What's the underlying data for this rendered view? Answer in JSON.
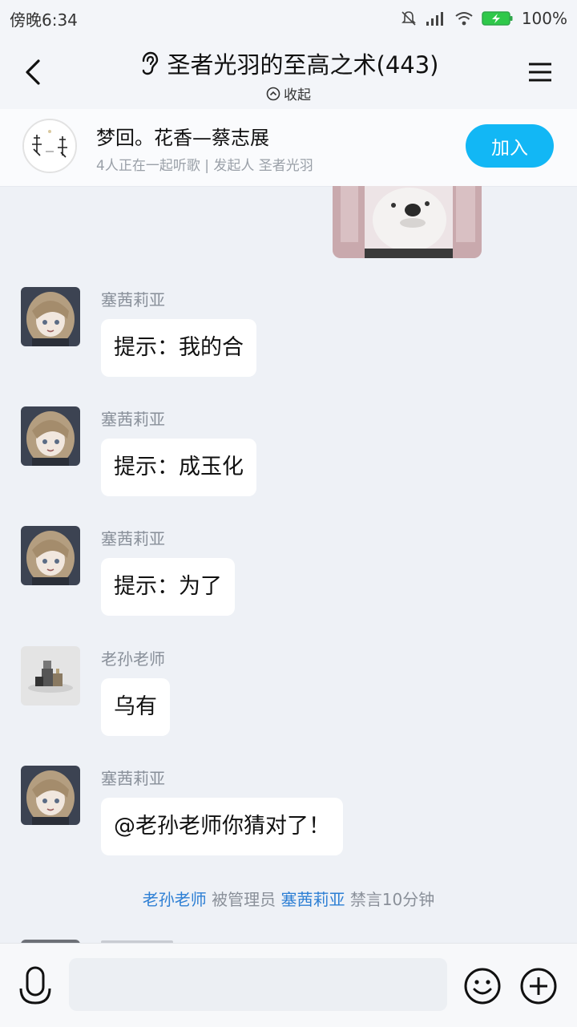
{
  "status_bar": {
    "time": "傍晚6:34",
    "battery": "100%",
    "icons": [
      "mute-bell-icon",
      "signal-icon",
      "wifi-icon",
      "battery-charging-icon"
    ]
  },
  "header": {
    "title": "圣者光羽的至高之术(443)",
    "collapse_label": "收起",
    "icons": [
      "back-arrow-icon",
      "ear-icon",
      "collapse-circle-icon",
      "menu-icon"
    ]
  },
  "music_bar": {
    "song": "梦回。花香—蔡志展",
    "subtitle": "4人正在一起听歌 | 发起人 圣者光羽",
    "join_label": "加入"
  },
  "messages": [
    {
      "sender": "塞茜莉亚",
      "text": "提示：我的合"
    },
    {
      "sender": "塞茜莉亚",
      "text": "提示：成玉化"
    },
    {
      "sender": "塞茜莉亚",
      "text": "提示：为了"
    },
    {
      "sender": "老孙老师",
      "text": "乌有"
    },
    {
      "sender": "塞茜莉亚",
      "text": "@老孙老师你猜对了！"
    }
  ],
  "system_notice": {
    "target": "老孙老师",
    "middle": "被管理员",
    "admin": "塞茜莉亚",
    "action": "禁言10分钟"
  },
  "input_bar": {
    "placeholder": "",
    "icons": [
      "microphone-icon",
      "emoji-icon",
      "plus-icon"
    ]
  },
  "colors": {
    "accent": "#12b7f5",
    "link": "#2d7fd4",
    "background": "#eef1f6"
  }
}
